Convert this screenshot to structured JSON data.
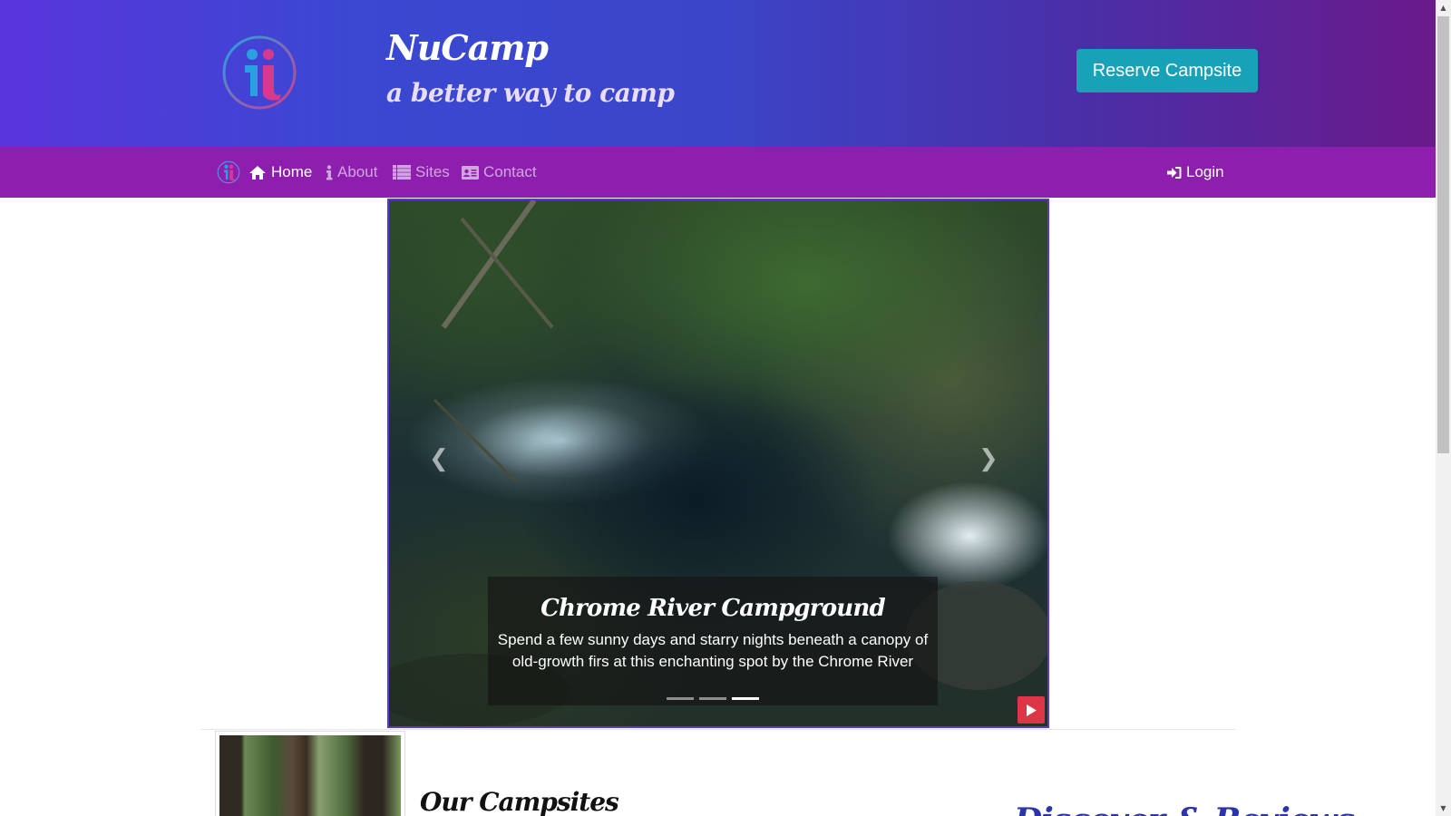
{
  "header": {
    "title": "NuCamp",
    "tagline": "a better way to camp",
    "reserve_label": "Reserve Campsite",
    "gradient_colors": [
      "#5a35dc",
      "#3b45c8",
      "#6a1a8a"
    ],
    "accent_color": "#17a2b8"
  },
  "navbar": {
    "background": "#8d1eae",
    "items": [
      {
        "label": "Home",
        "icon": "home-icon",
        "active": true
      },
      {
        "label": "About",
        "icon": "info-icon",
        "active": false
      },
      {
        "label": "Sites",
        "icon": "list-icon",
        "active": false
      },
      {
        "label": "Contact",
        "icon": "address-card-icon",
        "active": false
      }
    ],
    "login_label": "Login",
    "login_icon": "sign-in-icon"
  },
  "carousel": {
    "caption_title": "Chrome River Campground",
    "caption_text": "Spend a few sunny days and starry nights beneath a canopy of old-growth firs at this enchanting spot by the Chrome River",
    "prev_icon": "chevron-left-icon",
    "next_icon": "chevron-right-icon",
    "active_slide": 3,
    "slide_count": 3,
    "play_icon": "play-icon"
  },
  "section": {
    "title": "Our Campsites",
    "right_title": "Discover & Reviews"
  }
}
